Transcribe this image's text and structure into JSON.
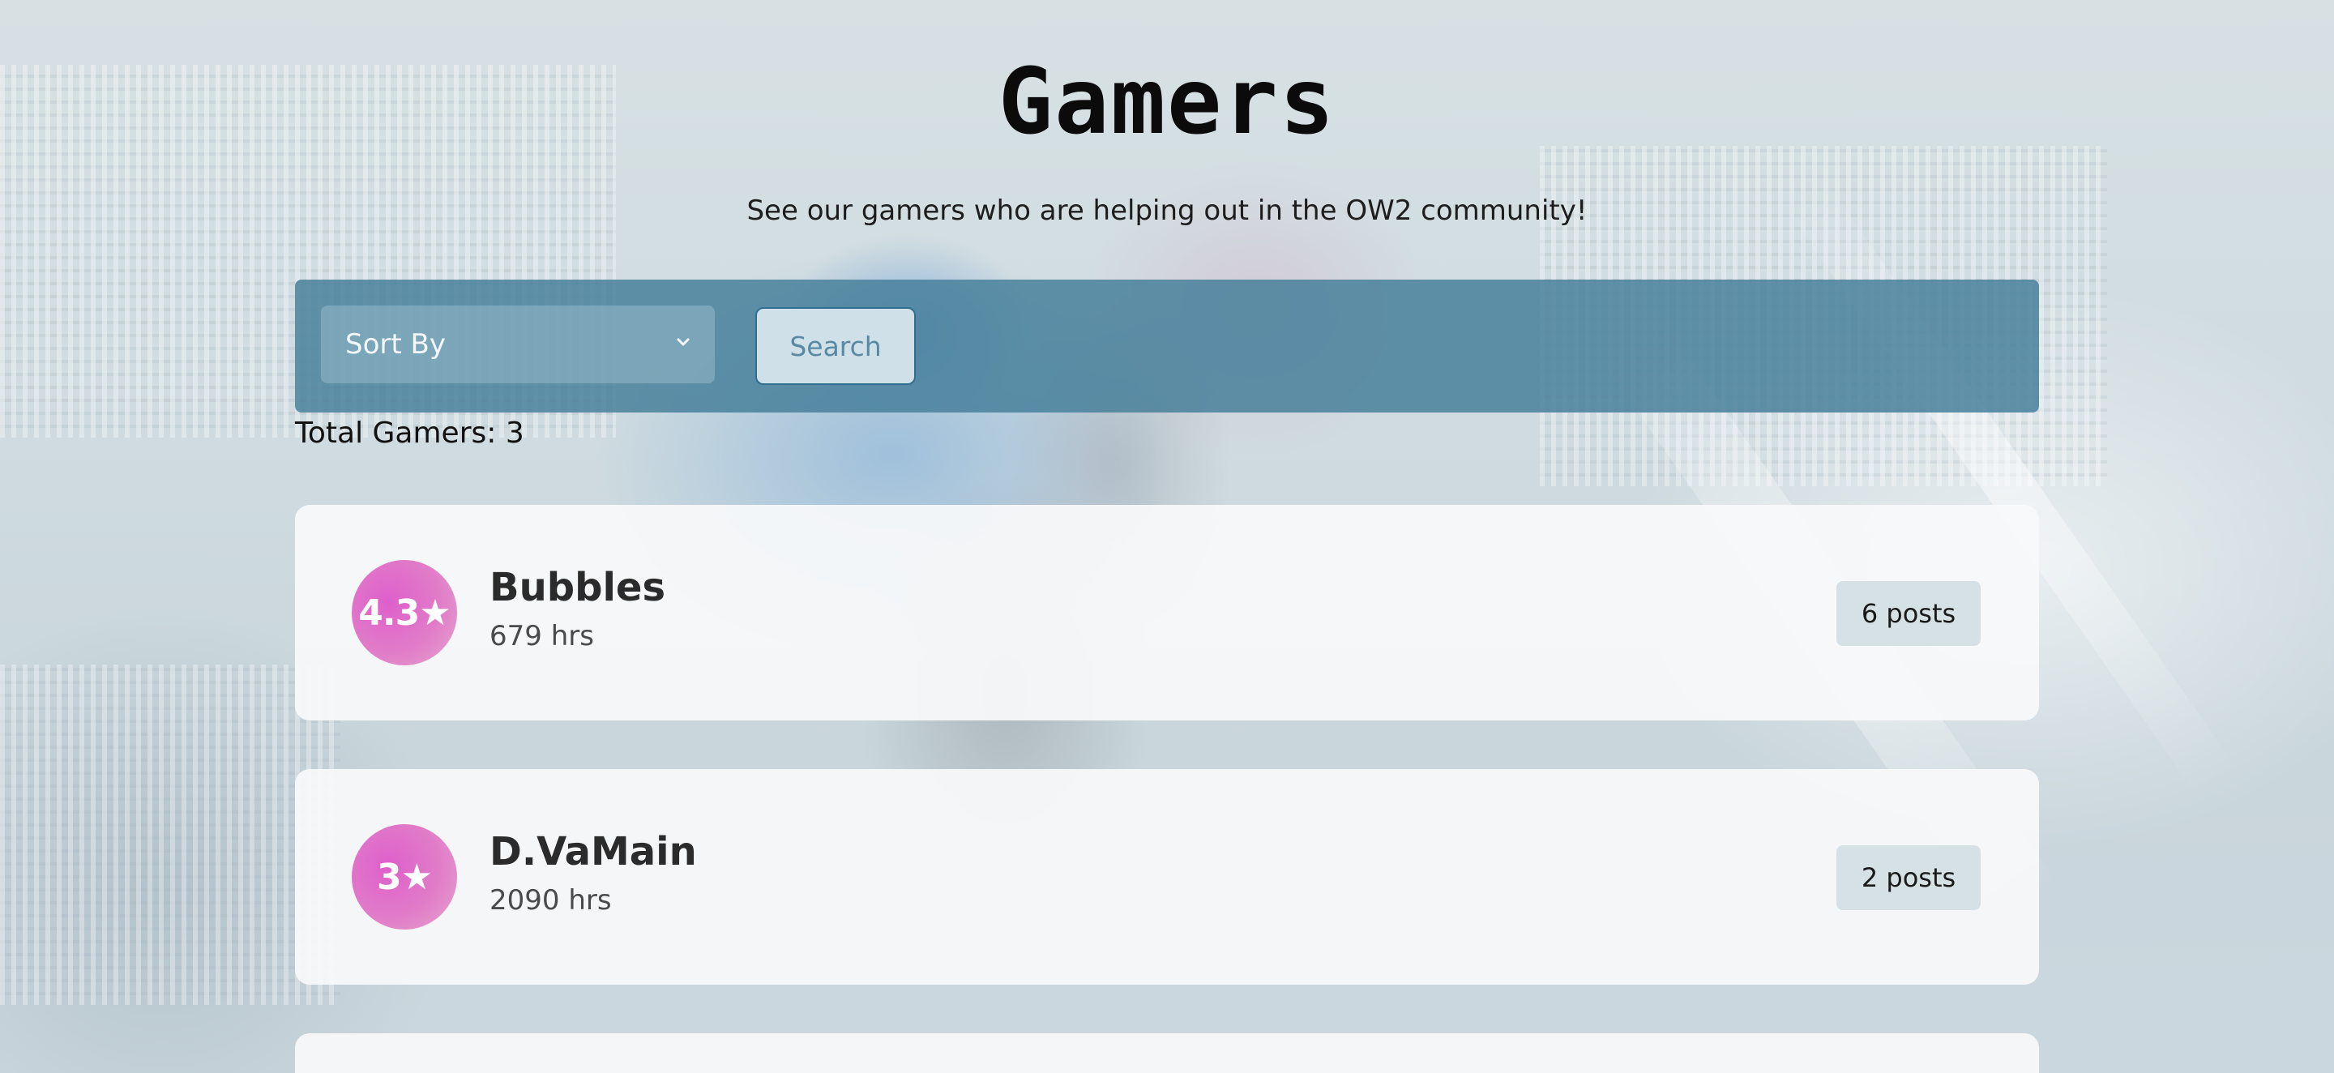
{
  "page": {
    "title": "Gamers",
    "subtitle": "See our gamers who are helping out in the OW2 community!"
  },
  "toolbar": {
    "sort_label": "Sort By",
    "search_label": "Search"
  },
  "summary": {
    "total_text": "Total Gamers: 3"
  },
  "gamers": [
    {
      "rating": "4.3★",
      "name": "Bubbles",
      "hours": "679 hrs",
      "posts": "6 posts"
    },
    {
      "rating": "3★",
      "name": "D.VaMain",
      "hours": "2090 hrs",
      "posts": "2 posts"
    },
    {
      "rating": "",
      "name": "",
      "hours": "",
      "posts": ""
    }
  ],
  "colors": {
    "toolbar_bg": "#48809b",
    "rating_badge": "#de5fcc",
    "posts_badge_bg": "#d5e1e5",
    "search_border": "#2f6f8d"
  },
  "icons": {
    "sort_chevron": "chevron-down-icon",
    "rating_star": "star"
  }
}
